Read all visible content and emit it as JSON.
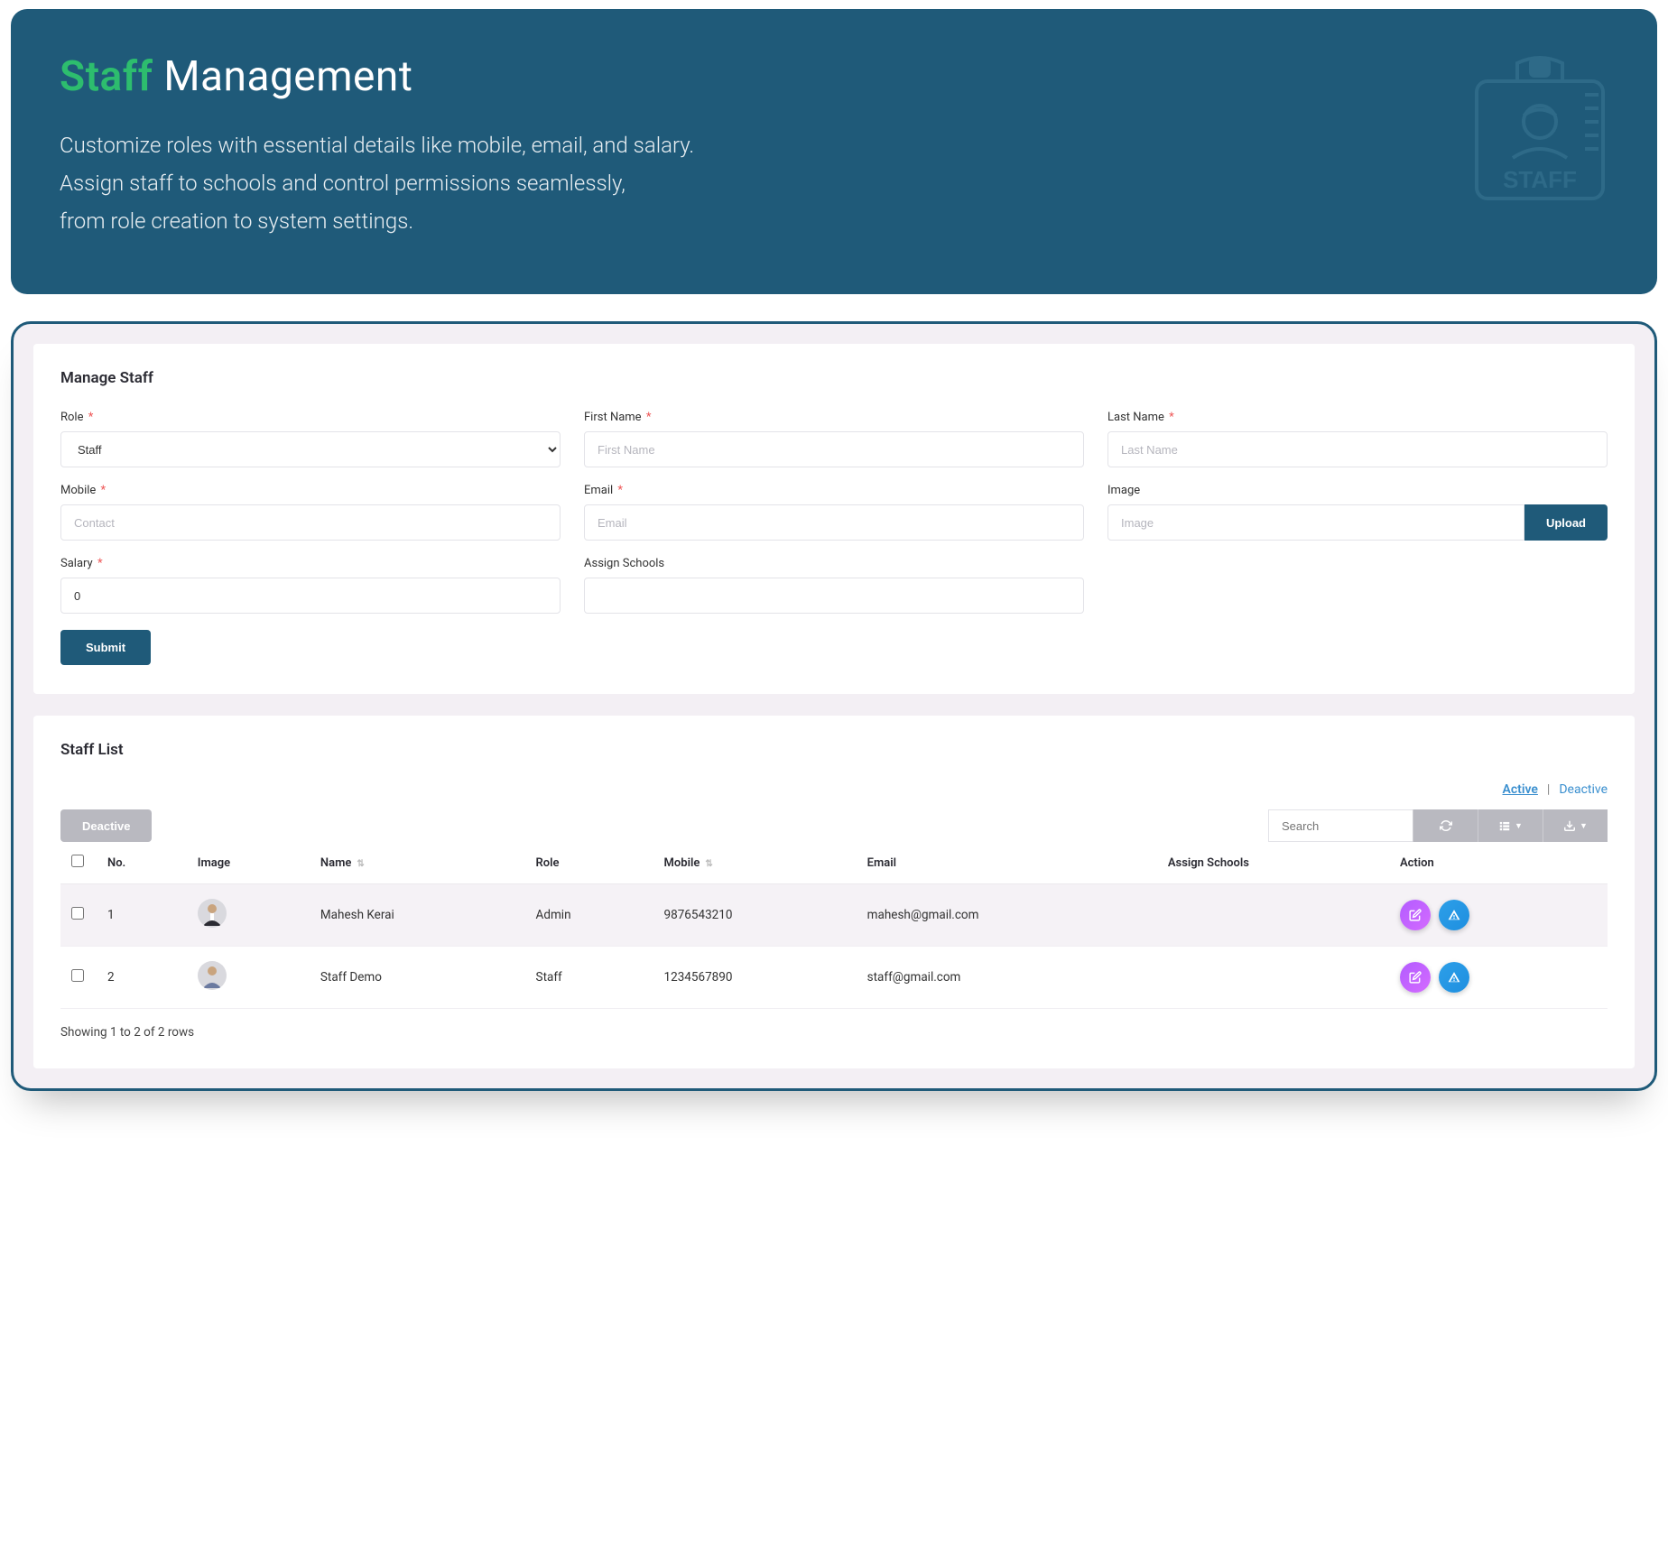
{
  "hero": {
    "title_accent": "Staff",
    "title_rest": "Management",
    "line1": "Customize roles with essential details like mobile, email, and salary.",
    "line2": "Assign staff to schools and control permissions seamlessly,",
    "line3": "from role creation to system settings."
  },
  "form": {
    "heading": "Manage Staff",
    "role": {
      "label": "Role",
      "value": "Staff",
      "required": true
    },
    "first_name": {
      "label": "First Name",
      "placeholder": "First Name",
      "required": true
    },
    "last_name": {
      "label": "Last Name",
      "placeholder": "Last Name",
      "required": true
    },
    "mobile": {
      "label": "Mobile",
      "placeholder": "Contact",
      "required": true
    },
    "email": {
      "label": "Email",
      "placeholder": "Email",
      "required": true
    },
    "image": {
      "label": "Image",
      "placeholder": "Image",
      "upload_label": "Upload",
      "required": false
    },
    "salary": {
      "label": "Salary",
      "value": "0",
      "required": true
    },
    "assign_schools": {
      "label": "Assign Schools",
      "required": false
    },
    "submit_label": "Submit"
  },
  "list": {
    "heading": "Staff List",
    "filter_active": "Active",
    "filter_deactive": "Deactive",
    "bulk_deactive": "Deactive",
    "search_placeholder": "Search",
    "columns": {
      "no": "No.",
      "image": "Image",
      "name": "Name",
      "role": "Role",
      "mobile": "Mobile",
      "email": "Email",
      "assign_schools": "Assign Schools",
      "action": "Action"
    },
    "rows": [
      {
        "no": "1",
        "name": "Mahesh Kerai",
        "role": "Admin",
        "mobile": "9876543210",
        "email": "mahesh@gmail.com",
        "assign_schools": ""
      },
      {
        "no": "2",
        "name": "Staff Demo",
        "role": "Staff",
        "mobile": "1234567890",
        "email": "staff@gmail.com",
        "assign_schools": ""
      }
    ],
    "pagination": "Showing 1 to 2 of 2 rows"
  }
}
